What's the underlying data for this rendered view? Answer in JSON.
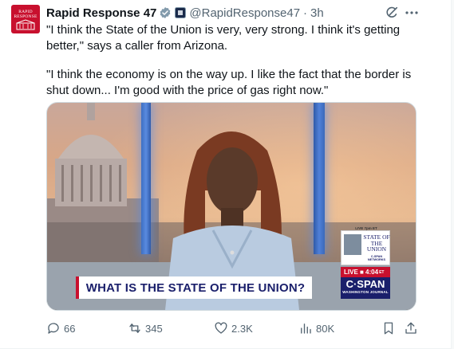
{
  "account": {
    "name": "Rapid Response 47",
    "handle": "@RapidResponse47",
    "separator": "·",
    "time": "3h",
    "avatar_text": "RAPID\nRESPONSE"
  },
  "tweet": {
    "paragraph_1": "\"I think the State of the Union is very, very strong. I think it's getting better,\" says a caller from Arizona.",
    "paragraph_2": "\"I think the economy is on the way up. I like the fact that the border is shut down... I'm good with the price of gas right now.\""
  },
  "media": {
    "chyron": "WHAT IS THE STATE OF THE UNION?",
    "live_top": "LIVE 7pm ET",
    "live_title": "STATE OF THE UNION",
    "live_network": "C-SPAN NETWORKS",
    "live_bar": "LIVE ■ 4:04",
    "live_bar_suffix": "ET",
    "logo": "C·SPAN",
    "logo_sub": "WASHINGTON JOURNAL"
  },
  "actions": {
    "replies": "66",
    "reposts": "345",
    "likes": "2.3K",
    "views": "80K"
  },
  "icons": {
    "verified": "verified-badge-icon",
    "affiliate": "affiliate-badge-icon",
    "grok": "grok-icon",
    "more": "more-icon",
    "reply": "reply-icon",
    "repost": "repost-icon",
    "like": "like-icon",
    "views": "views-icon",
    "bookmark": "bookmark-icon",
    "share": "share-icon"
  },
  "colors": {
    "accent": "#1d9bf0",
    "text": "#0f1419",
    "secondary": "#536471",
    "avatar_bg": "#c8102e",
    "cspan_navy": "#1a1f6b",
    "live_red": "#c8102e"
  }
}
